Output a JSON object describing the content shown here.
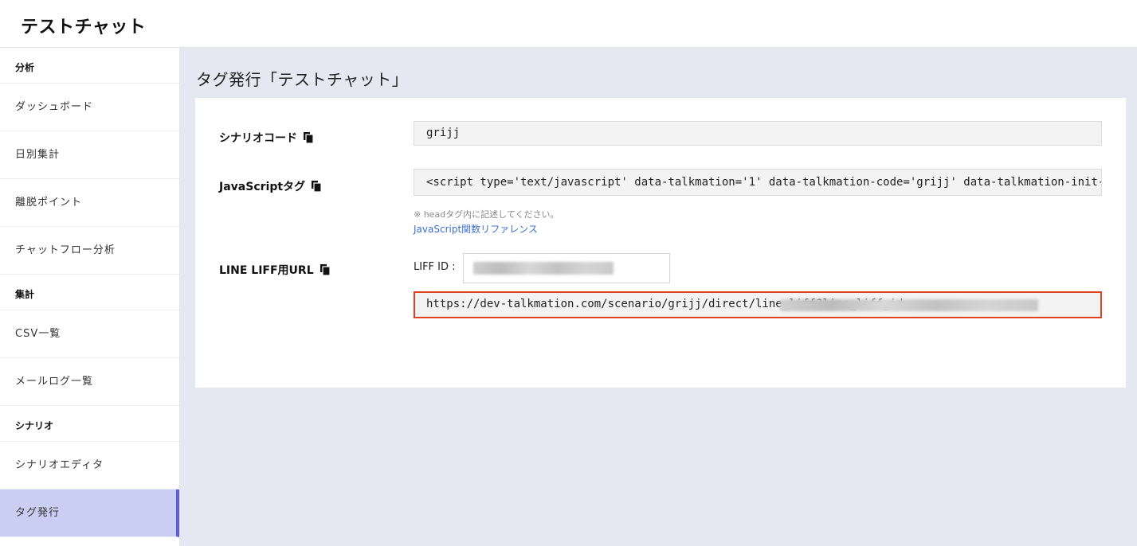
{
  "app": {
    "title": "テストチャット"
  },
  "sidebar": {
    "sections": [
      {
        "heading": "分析",
        "items": [
          "ダッシュボード",
          "日別集計",
          "離脱ポイント",
          "チャットフロー分析"
        ]
      },
      {
        "heading": "集計",
        "items": [
          "CSV一覧",
          "メールログ一覧"
        ]
      },
      {
        "heading": "シナリオ",
        "items": [
          "シナリオエディタ",
          "タグ発行"
        ]
      }
    ],
    "active_item": "タグ発行"
  },
  "main": {
    "page_title": "タグ発行「テストチャット」",
    "scenario_code": {
      "label": "シナリオコード",
      "value": "grijj",
      "icon": "copy-icon"
    },
    "js_tag": {
      "label": "JavaScriptタグ",
      "value": "<script type='text/javascript' data-talkmation='1' data-talkmation-code='grijj' data-talkmation-init-",
      "note": "※ headタグ内に記述してください。",
      "link": "JavaScript関数リファレンス",
      "icon": "copy-icon"
    },
    "line_liff": {
      "label": "LINE LIFF用URL",
      "liff_id_label": "LIFF ID :",
      "url": "https://dev-talkmation.com/scenario/grijj/direct/line_liff?line_liff_id=",
      "icon": "copy-icon"
    }
  },
  "colors": {
    "accent": "#5a5fd6",
    "active_bg": "#c9cef2",
    "highlight_border": "#e0411f",
    "link": "#3c6fd0"
  }
}
